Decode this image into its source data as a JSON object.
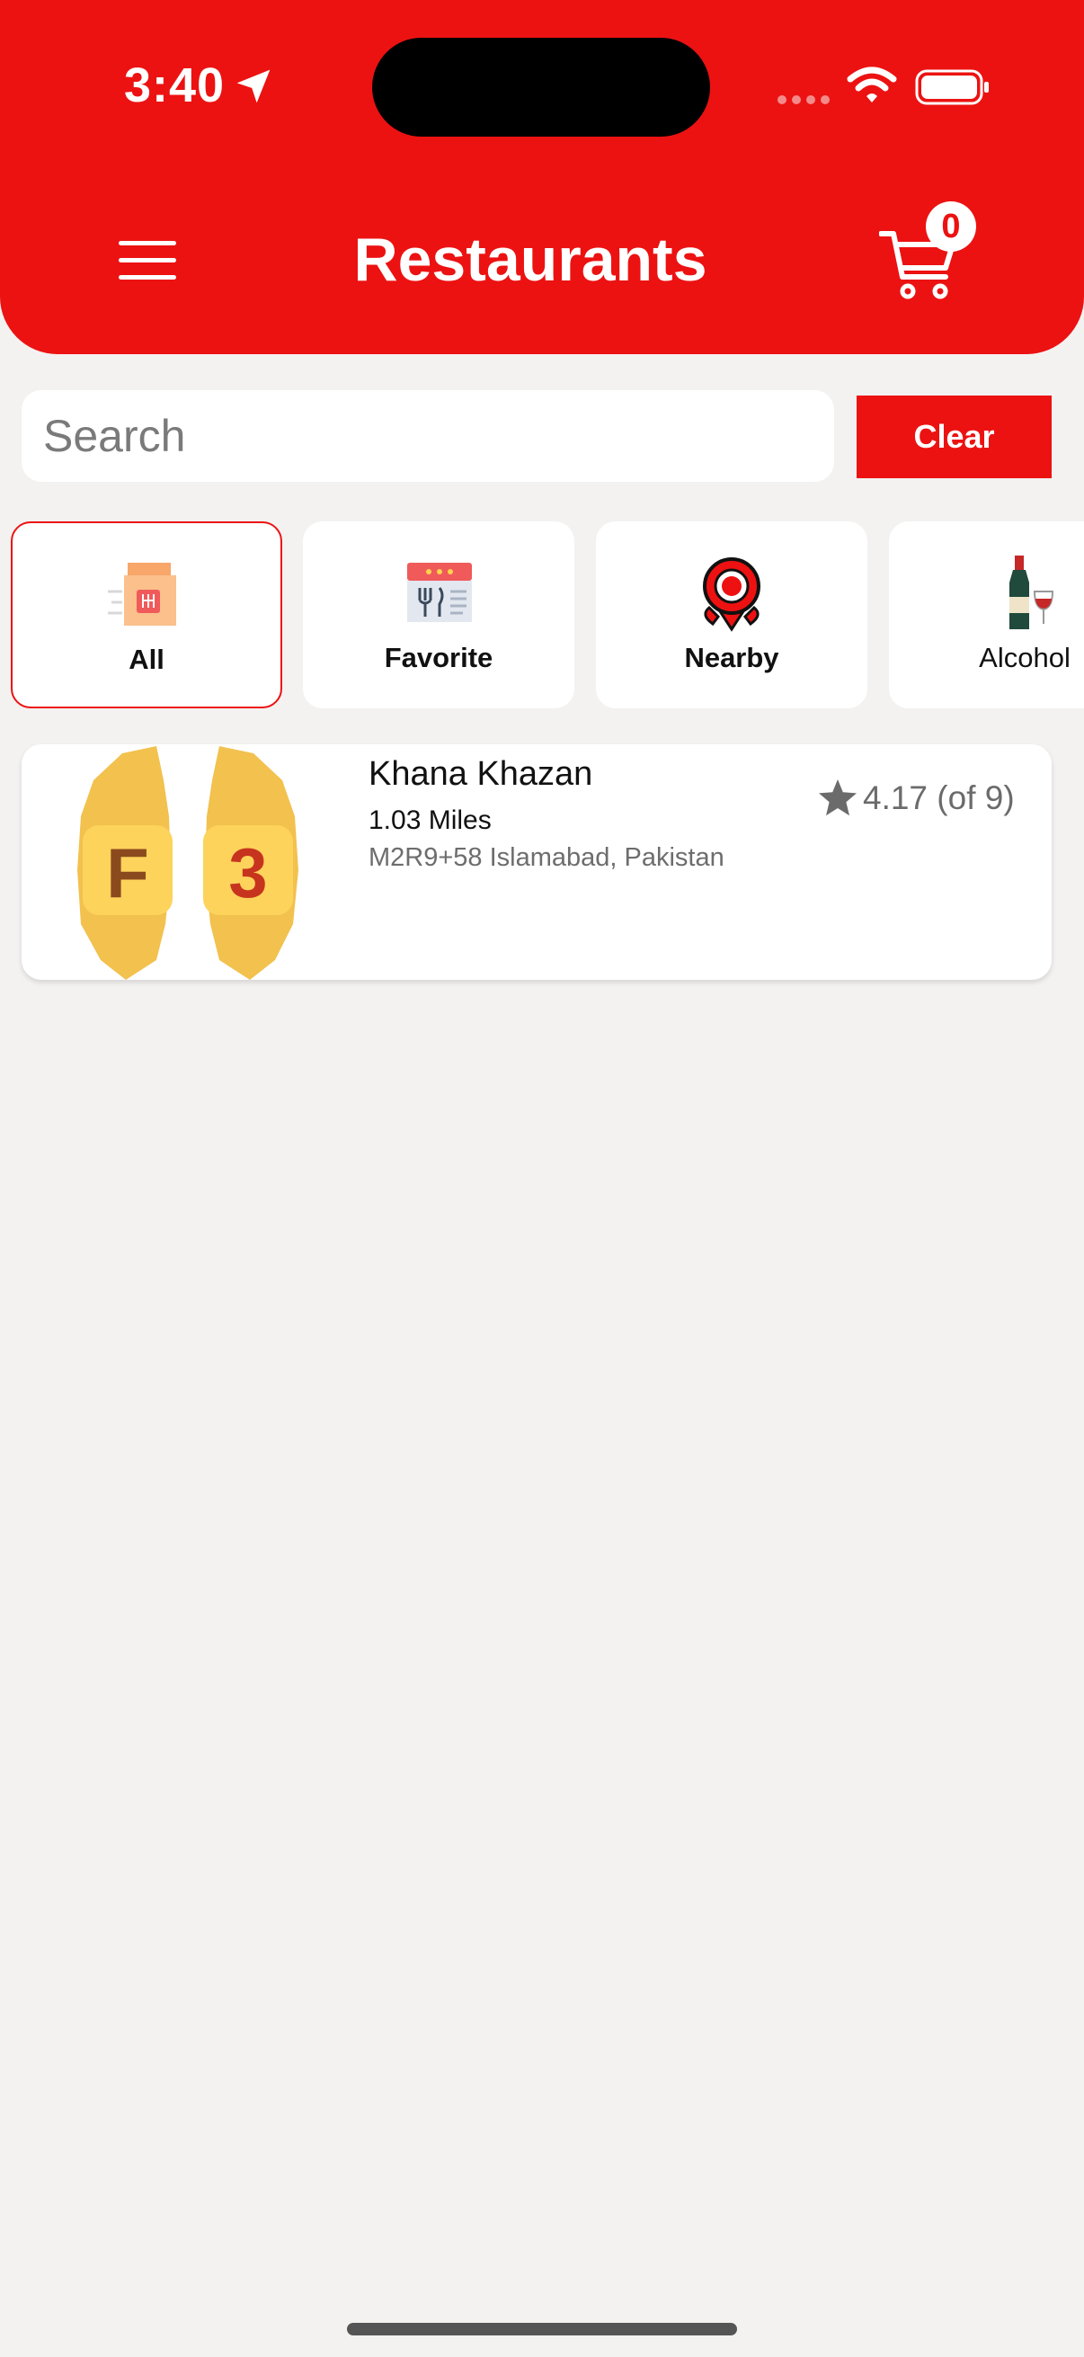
{
  "status_bar": {
    "time": "3:40"
  },
  "header": {
    "title": "Restaurants",
    "cart_count": "0"
  },
  "search": {
    "placeholder": "Search",
    "value": "",
    "clear_label": "Clear"
  },
  "categories": [
    {
      "label": "All",
      "icon": "food-bag-icon",
      "selected": true
    },
    {
      "label": "Favorite",
      "icon": "menu-board-icon",
      "selected": false
    },
    {
      "label": "Nearby",
      "icon": "map-pin-icon",
      "selected": false
    },
    {
      "label": "Alcohol",
      "icon": "wine-icon",
      "selected": false
    }
  ],
  "restaurants": [
    {
      "name": "Khana Khazan",
      "distance": "1.03 Miles",
      "address": "M2R9+58 Islamabad, Pakistan",
      "rating": "4.17 (of 9)",
      "logo_text": [
        "F",
        "3"
      ]
    }
  ],
  "colors": {
    "brand": "#ec1212",
    "background": "#f3f2f1",
    "card": "#ffffff",
    "muted_text": "#6d6d6d"
  }
}
